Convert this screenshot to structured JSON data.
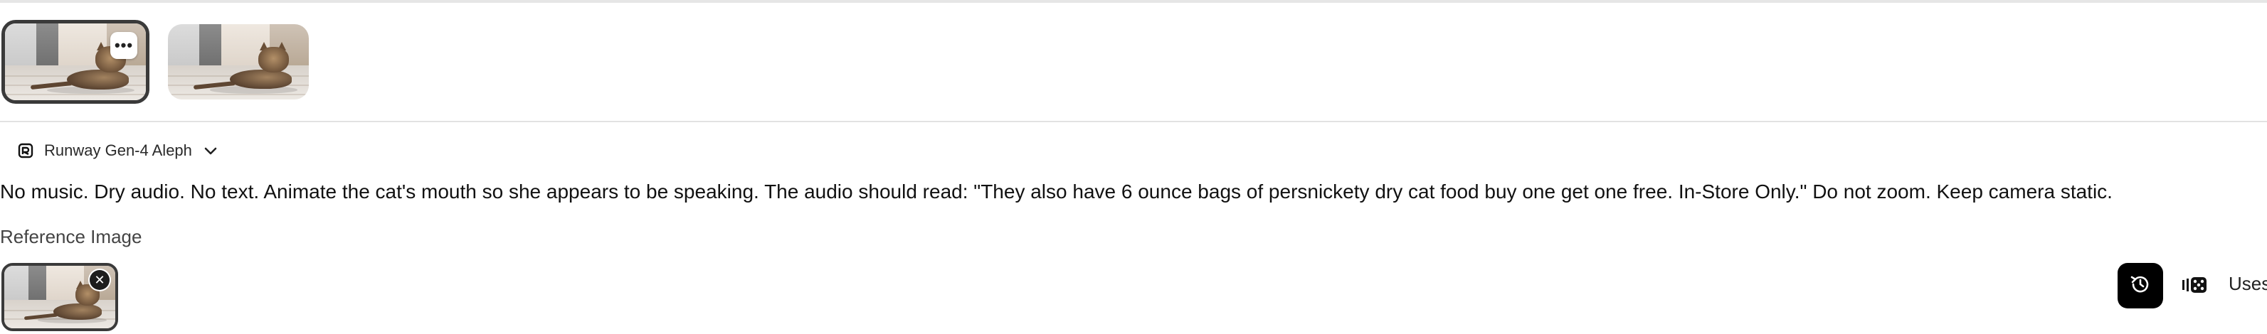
{
  "thumbnails": [
    {
      "label": "Generated variation 1",
      "selected": true,
      "more_icon": "ellipsis-icon"
    },
    {
      "label": "Generated variation 2",
      "selected": false
    }
  ],
  "model": {
    "name": "Runway Gen-4 Aleph",
    "icon": "runway-logo-icon",
    "dropdown_icon": "chevron-down-icon"
  },
  "prompt": {
    "text": "No music.  Dry audio. No text. Animate the cat's mouth so she appears to be speaking.  The audio should read: \"They also have 6 ounce bags of persnickety dry cat food buy one get one free. In-Store Only.\"  Do not zoom.  Keep camera static."
  },
  "reference": {
    "label": "Reference Image",
    "remove_icon": "close-icon"
  },
  "controls": {
    "history_icon": "history-icon",
    "seed_icon": "dice-icon",
    "uses_label": "Uses"
  },
  "colors": {
    "selected_border": "#3a3a3a",
    "history_button_bg": "#000000",
    "divider": "#e2e2e2"
  }
}
